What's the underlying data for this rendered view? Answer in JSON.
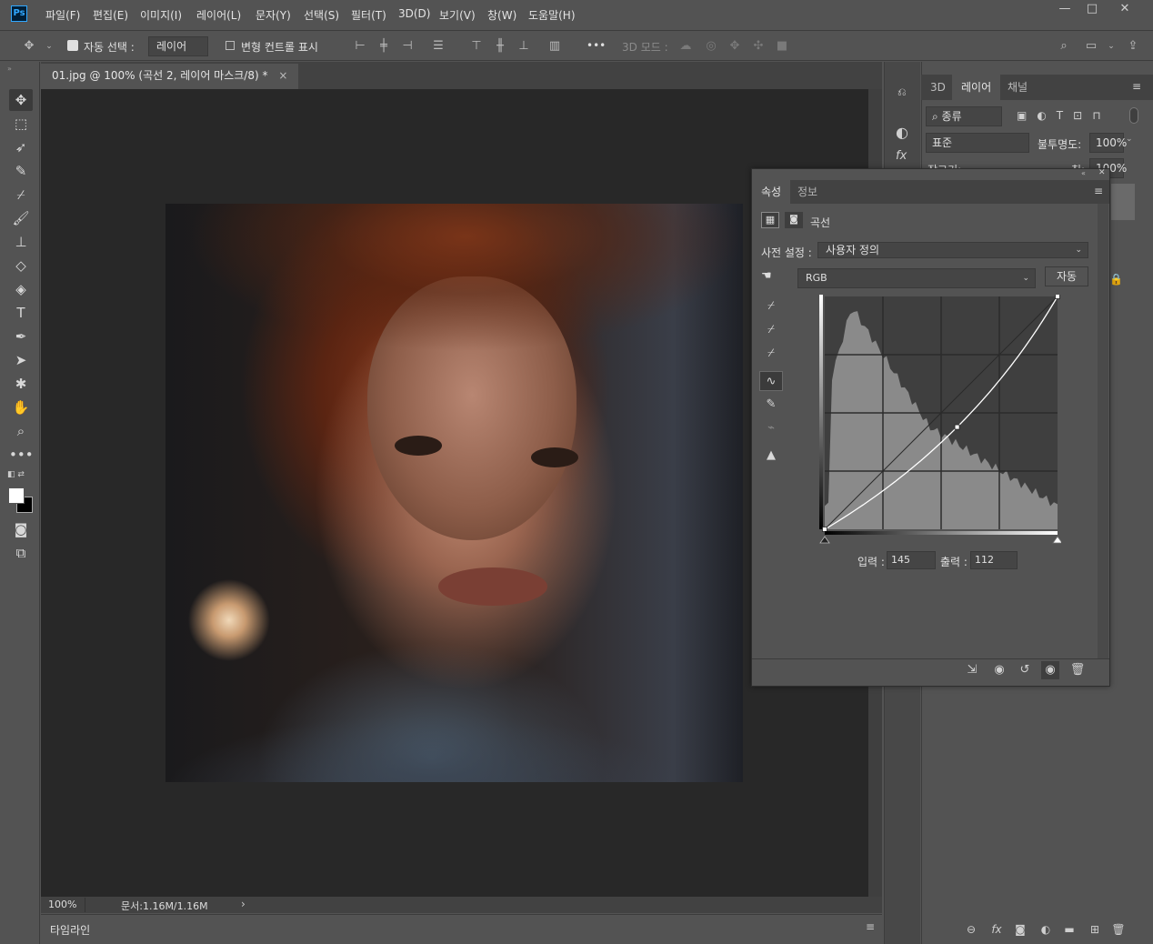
{
  "app": {
    "logo": "Ps",
    "menu": [
      "파일(F)",
      "편집(E)",
      "이미지(I)",
      "레이어(L)",
      "문자(Y)",
      "선택(S)",
      "필터(T)",
      "3D(D)",
      "보기(V)",
      "창(W)",
      "도움말(H)"
    ],
    "window_controls": {
      "minimize": "—",
      "maximize": "□",
      "close": "✕"
    }
  },
  "options_bar": {
    "auto_select_label": "자동 선택 :",
    "auto_select_value": "레이어",
    "transform_label": "변형 컨트롤 표시",
    "mode_3d_label": "3D 모드 :",
    "more": "•••"
  },
  "document": {
    "tab_title": "01.jpg @ 100% (곡선 2, 레이어 마스크/8) *",
    "zoom": "100%",
    "doc_size": "문서:1.16M/1.16M"
  },
  "timeline": {
    "label": "타임라인"
  },
  "layers_panel": {
    "tabs": [
      "3D",
      "레이어",
      "채널"
    ],
    "active_tab": "레이어",
    "filter_kind": "종류",
    "blend_mode": "표준",
    "opacity_label": "불투명도:",
    "opacity_value": "100%",
    "lock_label": "잠그기:",
    "fill_label": "칠:",
    "fill_value": "100%"
  },
  "properties_panel": {
    "tabs": [
      "속성",
      "정보"
    ],
    "active_tab": "속성",
    "adjustment_name": "곡선",
    "preset_label": "사전 설정 :",
    "preset_value": "사용자 정의",
    "channel_value": "RGB",
    "auto_button": "자동",
    "input_label": "입력 :",
    "input_value": "145",
    "output_label": "출력 :",
    "output_value": "112"
  },
  "curve": {
    "points": [
      [
        0,
        0
      ],
      [
        145,
        112
      ],
      [
        255,
        255
      ]
    ],
    "grid_divisions": 4
  },
  "colors": {
    "ui_bg": "#535353",
    "canvas_bg": "#282828",
    "curve_line": "#ffffff",
    "histogram": "#8a8a8a"
  }
}
